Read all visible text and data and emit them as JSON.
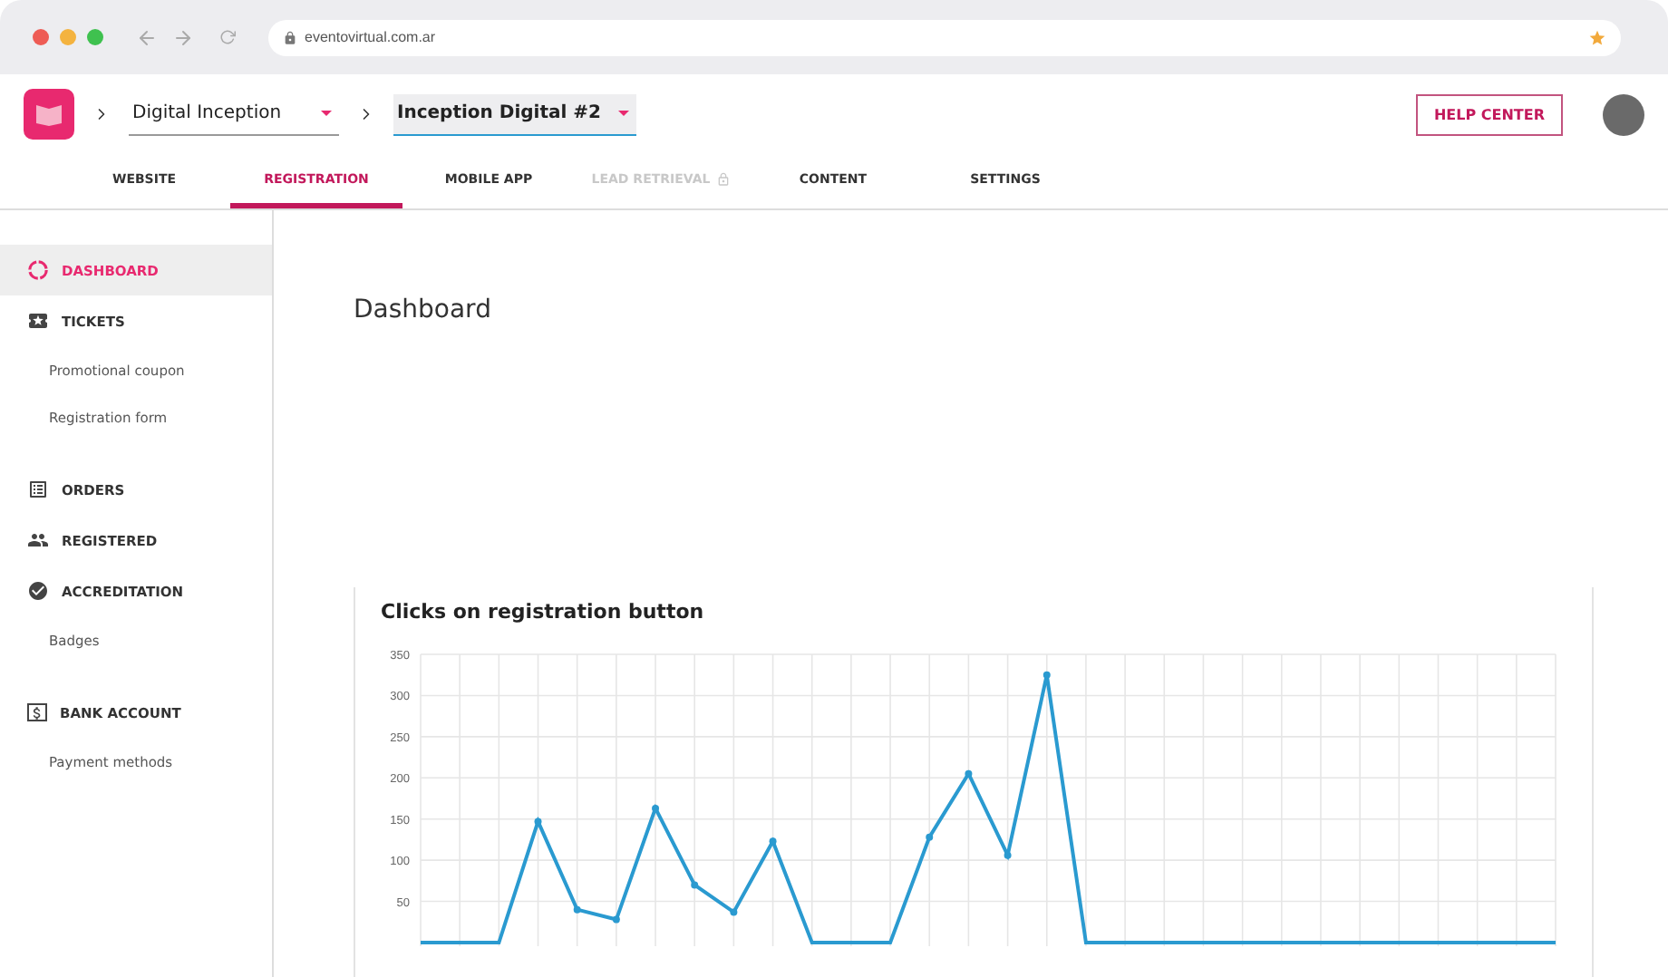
{
  "browser": {
    "url": "eventovirtual.com.ar"
  },
  "breadcrumb": [
    {
      "label": "Digital Inception",
      "focused": false
    },
    {
      "label": "Inception Digital #2",
      "focused": true
    }
  ],
  "help_button": "HELP CENTER",
  "tabs": [
    {
      "label": "WEBSITE",
      "selected": false,
      "disabled": false
    },
    {
      "label": "REGISTRATION",
      "selected": true,
      "disabled": false
    },
    {
      "label": "MOBILE APP",
      "selected": false,
      "disabled": false
    },
    {
      "label": "LEAD RETRIEVAL",
      "selected": false,
      "disabled": true
    },
    {
      "label": "CONTENT",
      "selected": false,
      "disabled": false
    },
    {
      "label": "SETTINGS",
      "selected": false,
      "disabled": false
    }
  ],
  "sidebar": {
    "items": [
      {
        "label": "DASHBOARD",
        "selected": true
      },
      {
        "label": "TICKETS",
        "selected": false,
        "children": [
          "Promotional coupon",
          "Registration form"
        ]
      },
      {
        "label": "ORDERS",
        "selected": false
      },
      {
        "label": "REGISTERED",
        "selected": false
      },
      {
        "label": "ACCREDITATION",
        "selected": false,
        "children": [
          "Badges"
        ]
      },
      {
        "label": "BANK ACCOUNT",
        "selected": false,
        "children": [
          "Payment methods"
        ]
      }
    ]
  },
  "page_title": "Dashboard",
  "chart_card": {
    "title": "Clicks on registration button",
    "chart_data": {
      "type": "line",
      "grid": true,
      "series": [
        {
          "color": "#2a9ad0",
          "values": [
            0,
            0,
            0,
            147,
            40,
            28,
            163,
            70,
            37,
            123,
            0,
            0,
            0,
            128,
            205,
            106,
            325,
            0,
            0,
            0,
            0,
            0,
            0,
            0,
            0,
            0,
            0,
            0,
            0,
            0
          ]
        }
      ],
      "ylim": [
        0,
        350
      ],
      "yticks": [
        50,
        100,
        150,
        200,
        250,
        300,
        350
      ]
    }
  }
}
